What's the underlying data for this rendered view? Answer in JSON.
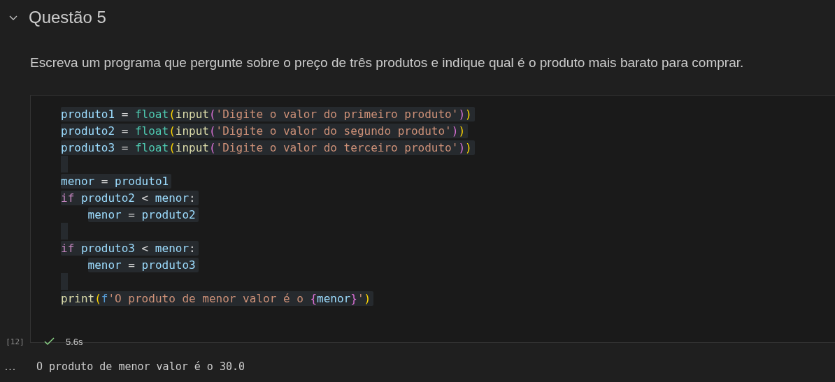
{
  "section": {
    "title": "Questão 5",
    "expanded": true
  },
  "description": "Escreva um programa que pergunte sobre o preço de três produtos e indique qual é o produto mais barato para comprar.",
  "cell": {
    "lines": [
      {
        "kind": "code",
        "selected": true,
        "tokens": [
          {
            "kind": "var",
            "text": "produto1"
          },
          {
            "kind": "op",
            "text": " = "
          },
          {
            "kind": "builtin",
            "text": "float"
          },
          {
            "kind": "bracket1",
            "text": "("
          },
          {
            "kind": "call",
            "text": "input"
          },
          {
            "kind": "bracket2",
            "text": "("
          },
          {
            "kind": "string",
            "text": "'Digite o valor do primeiro produto'"
          },
          {
            "kind": "bracket2",
            "text": ")"
          },
          {
            "kind": "bracket1",
            "text": ")"
          }
        ]
      },
      {
        "kind": "code",
        "selected": true,
        "tokens": [
          {
            "kind": "var",
            "text": "produto2"
          },
          {
            "kind": "op",
            "text": " = "
          },
          {
            "kind": "builtin",
            "text": "float"
          },
          {
            "kind": "bracket1",
            "text": "("
          },
          {
            "kind": "call",
            "text": "input"
          },
          {
            "kind": "bracket2",
            "text": "("
          },
          {
            "kind": "string",
            "text": "'Digite o valor do segundo produto'"
          },
          {
            "kind": "bracket2",
            "text": ")"
          },
          {
            "kind": "bracket1",
            "text": ")"
          }
        ]
      },
      {
        "kind": "code",
        "selected": true,
        "tokens": [
          {
            "kind": "var",
            "text": "produto3"
          },
          {
            "kind": "op",
            "text": " = "
          },
          {
            "kind": "builtin",
            "text": "float"
          },
          {
            "kind": "bracket1",
            "text": "("
          },
          {
            "kind": "call",
            "text": "input"
          },
          {
            "kind": "bracket2",
            "text": "("
          },
          {
            "kind": "string",
            "text": "'Digite o valor do terceiro produto'"
          },
          {
            "kind": "bracket2",
            "text": ")"
          },
          {
            "kind": "bracket1",
            "text": ")"
          }
        ]
      },
      {
        "kind": "blank",
        "selected": true
      },
      {
        "kind": "code",
        "selected": true,
        "tokens": [
          {
            "kind": "var",
            "text": "menor"
          },
          {
            "kind": "op",
            "text": " = "
          },
          {
            "kind": "var",
            "text": "produto1"
          }
        ]
      },
      {
        "kind": "code",
        "selected": true,
        "tokens": [
          {
            "kind": "keyword",
            "text": "if"
          },
          {
            "kind": "var",
            "text": "produto2"
          },
          {
            "kind": "op",
            "text": " < "
          },
          {
            "kind": "var",
            "text": "menor"
          },
          {
            "kind": "op",
            "text": ":"
          }
        ],
        "children": [
          {
            "kind": "code",
            "selected": true,
            "tokens": [
              {
                "kind": "var",
                "text": "menor"
              },
              {
                "kind": "op",
                "text": " = "
              },
              {
                "kind": "var",
                "text": "produto2"
              }
            ]
          }
        ]
      },
      {
        "kind": "blank",
        "selected": true
      },
      {
        "kind": "code",
        "selected": true,
        "tokens": [
          {
            "kind": "keyword",
            "text": "if"
          },
          {
            "kind": "var",
            "text": "produto3"
          },
          {
            "kind": "op",
            "text": " < "
          },
          {
            "kind": "var",
            "text": "menor"
          },
          {
            "kind": "op",
            "text": ":"
          }
        ],
        "children": [
          {
            "kind": "code",
            "selected": true,
            "tokens": [
              {
                "kind": "var",
                "text": "menor"
              },
              {
                "kind": "op",
                "text": " = "
              },
              {
                "kind": "var",
                "text": "produto3"
              }
            ]
          }
        ]
      },
      {
        "kind": "blank",
        "selected": true
      },
      {
        "kind": "code",
        "selected": true,
        "tokens": [
          {
            "kind": "call",
            "text": "print"
          },
          {
            "kind": "bracket1",
            "text": "("
          },
          {
            "kind": "fprefix",
            "text": "f"
          },
          {
            "kind": "string",
            "text": "'O produto de menor valor é o "
          },
          {
            "kind": "bracket2",
            "text": "{"
          },
          {
            "kind": "var",
            "text": "menor"
          },
          {
            "kind": "bracket2",
            "text": "}"
          },
          {
            "kind": "string",
            "text": "'"
          },
          {
            "kind": "bracket1",
            "text": ")"
          }
        ]
      }
    ],
    "execution_count": "[12]",
    "succeeded": true,
    "duration": "5.6s"
  },
  "output": {
    "more": "...",
    "text": "O produto de menor valor é o 30.0"
  }
}
